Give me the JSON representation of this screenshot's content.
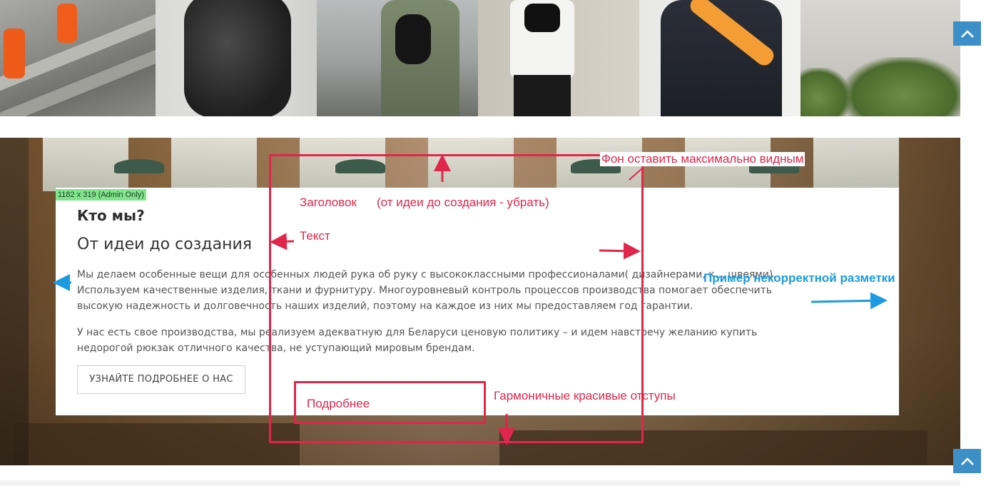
{
  "admin_badge": "1182 x 319 (Admin Only)",
  "about": {
    "title": "Кто мы?",
    "subtitle": "От идеи до создания",
    "paragraph_1": "Мы делаем особенные вещи для особенных людей рука об руку с высококлассными профессионалами( дизайнерами, к… швеями). Используем качественные изделия, ткани и фурнитуру. Многоуровневый контроль процессов производства помогает обеспечить высокую надежность и долговечность наших изделий, поэтому на каждое из них мы предоставляем год гарантии.",
    "paragraph_2": "У нас есть свое производства, мы реализуем адекватную для Беларуси ценовую политику – и идем навстречу желанию купить недорогой рюкзак отличного качества, не уступающий мировым брендам.",
    "button_label": "УЗНАЙТЕ ПОДРОБНЕЕ О НАС"
  },
  "annotations": {
    "background_note": "Фон оставить максимально видным",
    "heading_note": "Заголовок",
    "heading_remove_note": "(от идеи до создания - убрать)",
    "text_note": "Текст",
    "incorrect_markup_note": "Пример некорректной разметки",
    "more_box_label": "Подробнее",
    "spacing_note": "Гармоничные красивые отступы"
  },
  "colors": {
    "annotation_red": "#e0264a",
    "annotation_blue": "#1a9be0",
    "scroll_button": "#3d8fc7",
    "admin_badge": "#7fe58c"
  },
  "icons": {
    "scroll_top": "chevron-up-icon"
  }
}
